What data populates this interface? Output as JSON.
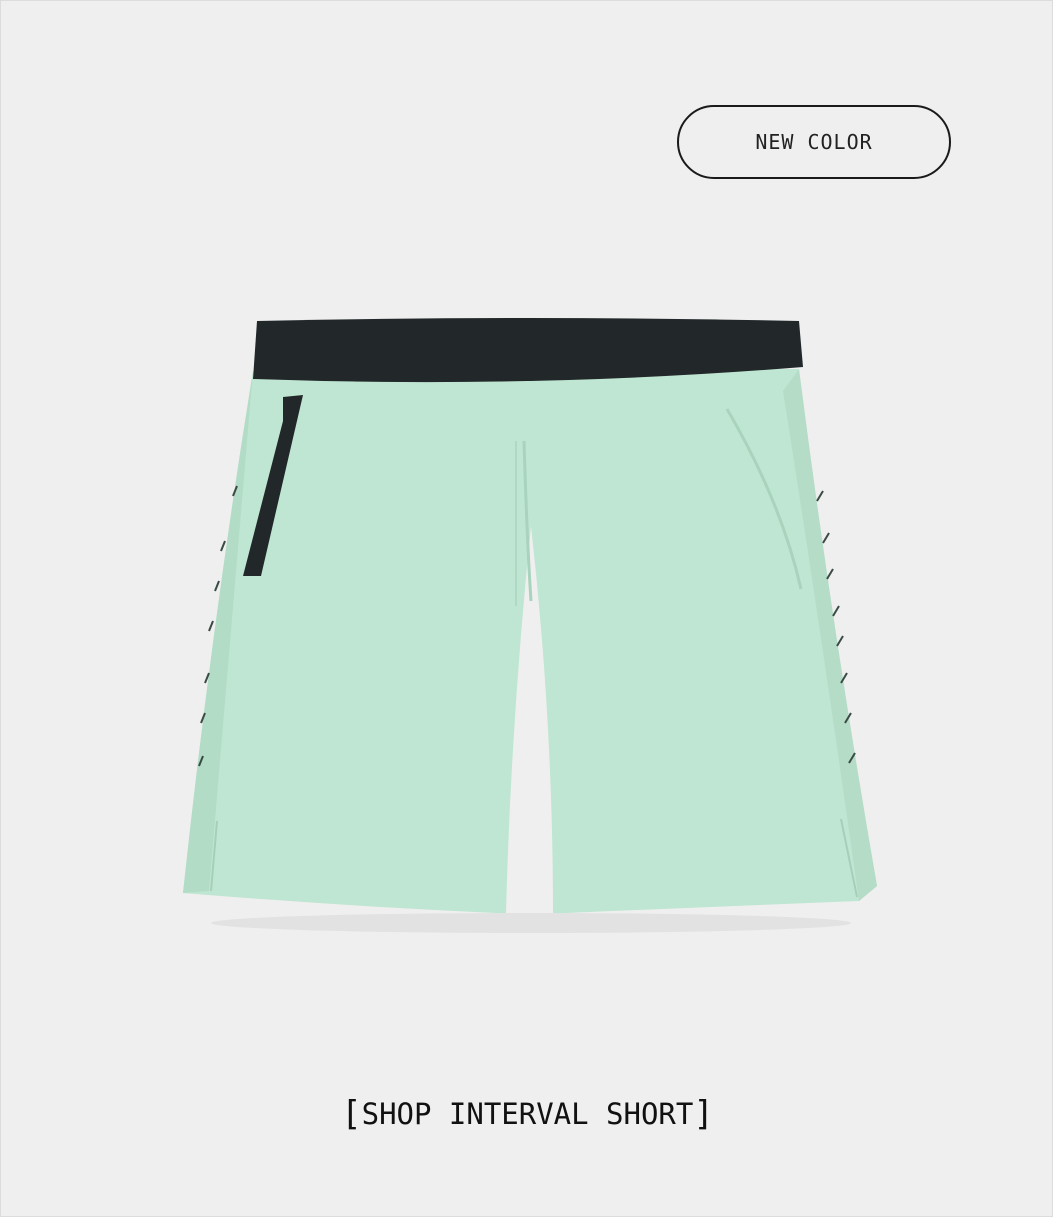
{
  "badge": {
    "label": "NEW COLOR"
  },
  "product": {
    "icon": "shorts-product-image",
    "colors": {
      "fabric": "#bfe6d2",
      "waistband": "#22282a"
    }
  },
  "cta": {
    "open_bracket": "[",
    "label": "SHOP INTERVAL SHORT",
    "close_bracket": "]"
  },
  "colors": {
    "background": "#efefef",
    "text": "#111111"
  }
}
